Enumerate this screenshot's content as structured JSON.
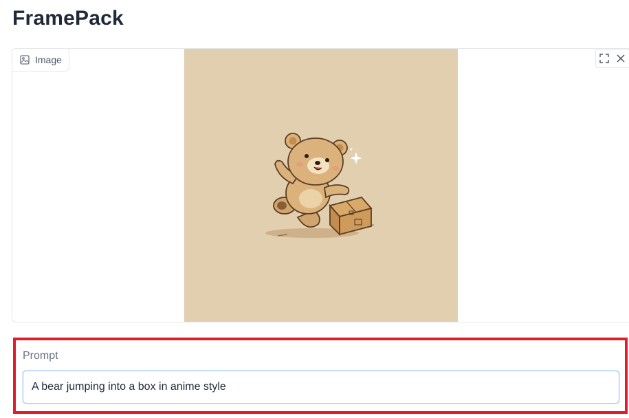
{
  "app": {
    "title": "FramePack"
  },
  "image_input": {
    "label": "Image",
    "label_icon": "image-icon",
    "tools": [
      {
        "icon": "fullscreen-icon"
      },
      {
        "icon": "close-icon"
      }
    ],
    "preview_background": "#e2cfb0"
  },
  "prompt": {
    "label": "Prompt",
    "value": "A bear jumping into a box in anime style"
  },
  "colors": {
    "highlight_border": "#e11d2a",
    "input_focus_border": "#93c5fd"
  }
}
